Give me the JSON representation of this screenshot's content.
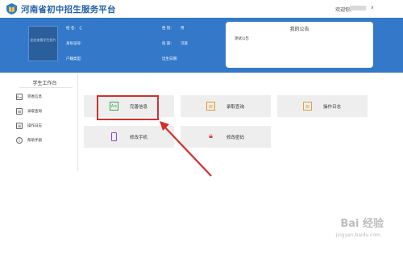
{
  "header": {
    "site_title": "河南省初中招生服务平台",
    "welcome": "欢迎你,",
    "dropdown": "∨",
    "logo_icon": "book-shield-icon"
  },
  "student": {
    "photo_text": "此处查看学生照片",
    "name_label": "姓  名:",
    "name_value": "",
    "gender_label": "性  别:",
    "gender_value": "男",
    "id_label": "身份证号:",
    "ethnic_label": "民  族:",
    "ethnic_value": "汉族",
    "hukou_label": "户籍类型:",
    "birth_label": "出生日期:"
  },
  "notice": {
    "title": "我的公告",
    "item": "测试公告"
  },
  "sidebar": {
    "title": "学生工作台",
    "items": [
      {
        "label": "完善信息",
        "icon": "id-card-icon"
      },
      {
        "label": "录取查询",
        "icon": "document-search-icon"
      },
      {
        "label": "操作日志",
        "icon": "log-icon"
      },
      {
        "label": "帮助手册",
        "icon": "info-icon"
      }
    ]
  },
  "tiles": [
    {
      "label": "完善信息",
      "icon": "id-card-icon",
      "color": "#3aa657"
    },
    {
      "label": "录取查询",
      "icon": "document-search-icon",
      "color": "#e39a2e"
    },
    {
      "label": "操作日志",
      "icon": "log-icon",
      "color": "#d9a441"
    },
    {
      "label": "修改手机",
      "icon": "phone-icon",
      "color": "#8e44c9"
    },
    {
      "label": "修改密码",
      "icon": "lock-icon",
      "color": "#d93a3a"
    }
  ],
  "watermark": {
    "main": "Bai 经验",
    "sub": "jingyan.baidu.com"
  },
  "colors": {
    "banner": "#3479c9",
    "brand": "#1f5fa8",
    "highlight": "#d32f2f"
  }
}
